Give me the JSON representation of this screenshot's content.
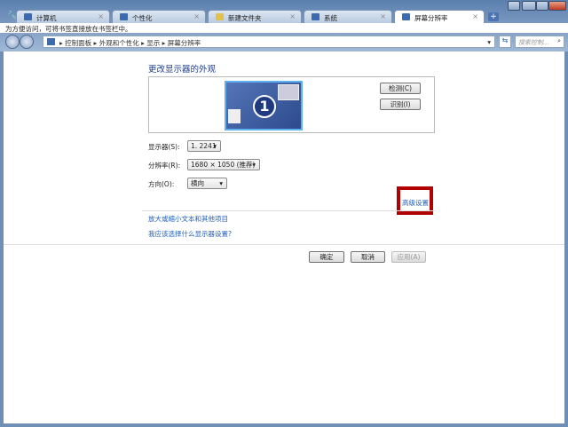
{
  "tabs": [
    {
      "label": "计算机",
      "icon": "computer-icon"
    },
    {
      "label": "个性化",
      "icon": "personalize-icon"
    },
    {
      "label": "新建文件夹",
      "icon": "folder-icon"
    },
    {
      "label": "系统",
      "icon": "system-icon"
    },
    {
      "label": "屏幕分辨率",
      "icon": "display-icon",
      "active": true
    }
  ],
  "bookmark_bar": "为方便访问，可将书签直接放在书签栏中。",
  "breadcrumb": [
    "控制面板",
    "外观和个性化",
    "显示",
    "屏幕分辨率"
  ],
  "search_placeholder": "搜索控制...",
  "page": {
    "title": "更改显示器的外观",
    "monitor_number": "1",
    "detect": "检测(C)",
    "identify": "识别(I)",
    "display_label": "显示器(S):",
    "display_value": "1. 2241",
    "resolution_label": "分辨率(R):",
    "resolution_value": "1680 × 1050 (推荐)",
    "orientation_label": "方向(O):",
    "orientation_value": "横向",
    "advanced": "高级设置",
    "link1": "放大或缩小文本和其他项目",
    "link2": "我应该选择什么显示器设置?",
    "ok": "确定",
    "cancel": "取消",
    "apply": "应用(A)"
  },
  "colors": {
    "highlight": "#b00000",
    "link": "#1f5fbf",
    "monitor": "#3a5b9e"
  }
}
